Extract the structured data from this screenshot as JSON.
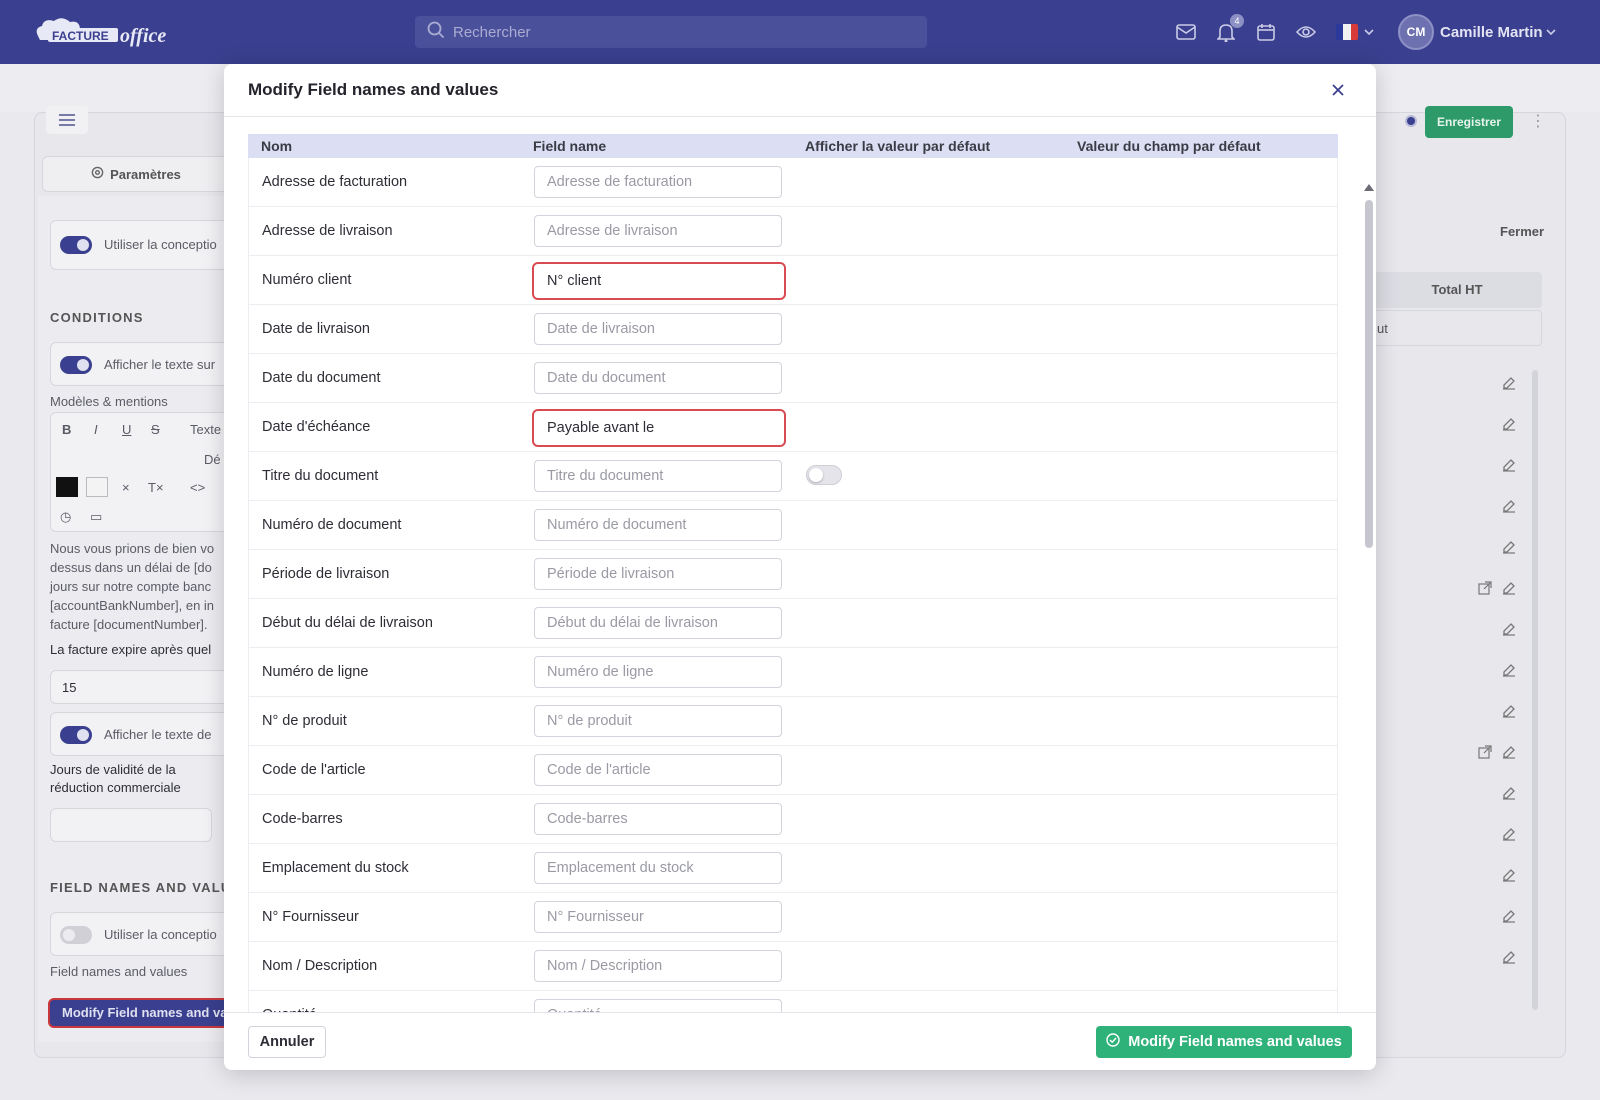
{
  "topbar": {
    "brand": "FACTURE office",
    "search_placeholder": "Rechercher",
    "notification_count": "4",
    "user_initials": "CM",
    "user_name": "Camille Martin",
    "accent_color": "#3a3f8f"
  },
  "background": {
    "save_label": "Enregistrer",
    "params_tab": "Paramètres",
    "close_label": "Fermer",
    "total_ht": "Total HT",
    "partial_right": "ut",
    "left": {
      "use_design_1": "Utiliser la conceptio",
      "conditions_heading": "CONDITIONS",
      "show_text_1": "Afficher le texte sur",
      "models_label": "Modèles & mentions",
      "text_select": "Texte",
      "def_select": "Dé",
      "body_lines": [
        "Nous vous prions de bien vo",
        "dessus dans un délai de [do",
        "jours sur notre compte banc",
        "[accountBankNumber], en in",
        "facture [documentNumber]."
      ],
      "expire_label": "La facture expire après quel",
      "expire_value": "15",
      "show_text_2": "Afficher le texte de",
      "validity_label_1": "Jours de validité de la",
      "validity_label_2": "réduction commerciale",
      "field_names_heading": "FIELD NAMES AND VALU",
      "use_design_2": "Utiliser la conceptio",
      "field_names_label": "Field names and values",
      "modify_button": "Modify Field names and va"
    }
  },
  "modal": {
    "title": "Modify Field names and values",
    "columns": [
      "Nom",
      "Field name",
      "Afficher la valeur par défaut",
      "Valeur du champ par défaut"
    ],
    "rows": [
      {
        "name": "Adresse de facturation",
        "placeholder": "Adresse de facturation",
        "value": ""
      },
      {
        "name": "Adresse de livraison",
        "placeholder": "Adresse de livraison",
        "value": ""
      },
      {
        "name": "Numéro client",
        "placeholder": "Numéro client",
        "value": "N° client"
      },
      {
        "name": "Date de livraison",
        "placeholder": "Date de livraison",
        "value": ""
      },
      {
        "name": "Date du document",
        "placeholder": "Date du document",
        "value": ""
      },
      {
        "name": "Date d'échéance",
        "placeholder": "Date d'échéance",
        "value": "Payable avant le"
      },
      {
        "name": "Titre du document",
        "placeholder": "Titre du document",
        "value": "",
        "toggle": false
      },
      {
        "name": "Numéro de document",
        "placeholder": "Numéro de document",
        "value": ""
      },
      {
        "name": "Période de livraison",
        "placeholder": "Période de livraison",
        "value": ""
      },
      {
        "name": "Début du délai de livraison",
        "placeholder": "Début du délai de livraison",
        "value": ""
      },
      {
        "name": "Numéro de ligne",
        "placeholder": "Numéro de ligne",
        "value": ""
      },
      {
        "name": "N° de produit",
        "placeholder": "N° de produit",
        "value": ""
      },
      {
        "name": "Code de l'article",
        "placeholder": "Code de l'article",
        "value": ""
      },
      {
        "name": "Code-barres",
        "placeholder": "Code-barres",
        "value": ""
      },
      {
        "name": "Emplacement du stock",
        "placeholder": "Emplacement du stock",
        "value": ""
      },
      {
        "name": "N° Fournisseur",
        "placeholder": "N° Fournisseur",
        "value": ""
      },
      {
        "name": "Nom / Description",
        "placeholder": "Nom / Description",
        "value": ""
      },
      {
        "name": "Quantité",
        "placeholder": "Quantité",
        "value": ""
      }
    ],
    "cancel_label": "Annuler",
    "submit_label": "Modify Field names and values",
    "submit_color": "#2fb27a",
    "highlight_color": "#d84b52"
  }
}
